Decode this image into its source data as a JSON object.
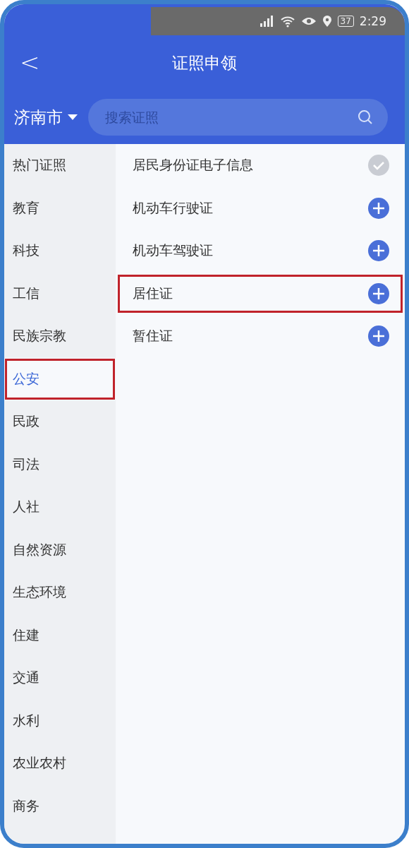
{
  "status_bar": {
    "battery": "37",
    "time": "2:29"
  },
  "header": {
    "back": "<",
    "title": "证照申领"
  },
  "search": {
    "city": "济南市",
    "placeholder": "搜索证照"
  },
  "sidebar": {
    "items": [
      {
        "label": "热门证照",
        "selected": false,
        "highlighted": false
      },
      {
        "label": "教育",
        "selected": false,
        "highlighted": false
      },
      {
        "label": "科技",
        "selected": false,
        "highlighted": false
      },
      {
        "label": "工信",
        "selected": false,
        "highlighted": false
      },
      {
        "label": "民族宗教",
        "selected": false,
        "highlighted": false
      },
      {
        "label": "公安",
        "selected": true,
        "highlighted": true
      },
      {
        "label": "民政",
        "selected": false,
        "highlighted": false
      },
      {
        "label": "司法",
        "selected": false,
        "highlighted": false
      },
      {
        "label": "人社",
        "selected": false,
        "highlighted": false
      },
      {
        "label": "自然资源",
        "selected": false,
        "highlighted": false
      },
      {
        "label": "生态环境",
        "selected": false,
        "highlighted": false
      },
      {
        "label": "住建",
        "selected": false,
        "highlighted": false
      },
      {
        "label": "交通",
        "selected": false,
        "highlighted": false
      },
      {
        "label": "水利",
        "selected": false,
        "highlighted": false
      },
      {
        "label": "农业农村",
        "selected": false,
        "highlighted": false
      },
      {
        "label": "商务",
        "selected": false,
        "highlighted": false
      }
    ]
  },
  "licenses": [
    {
      "label": "居民身份证电子信息",
      "added": true,
      "highlighted": false
    },
    {
      "label": "机动车行驶证",
      "added": false,
      "highlighted": false
    },
    {
      "label": "机动车驾驶证",
      "added": false,
      "highlighted": false
    },
    {
      "label": "居住证",
      "added": false,
      "highlighted": true
    },
    {
      "label": "暂住证",
      "added": false,
      "highlighted": false
    }
  ]
}
